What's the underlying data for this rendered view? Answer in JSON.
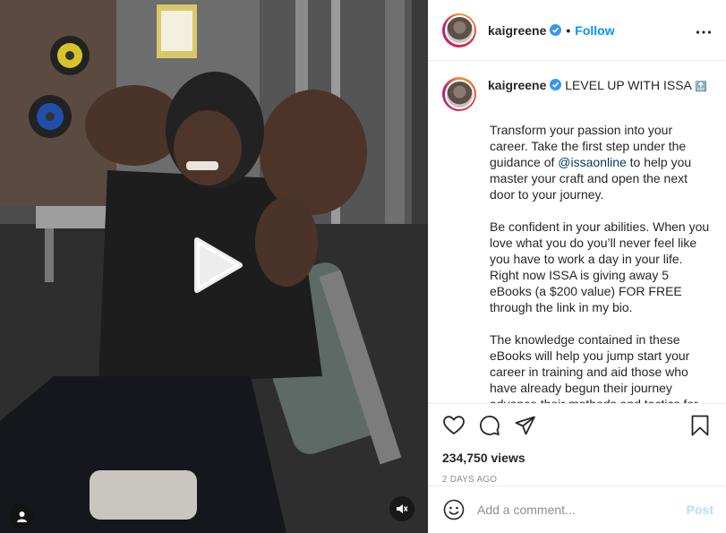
{
  "post": {
    "username": "kaigreene",
    "follow_label": "Follow",
    "separator": "•",
    "more_icon": "more-horizontal-icon"
  },
  "caption": {
    "username": "kaigreene",
    "headline": "LEVEL UP WITH ISSA",
    "headline_emoji": "🔝",
    "para1_before": "Transform your passion into your career. Take the first step under the guidance of ",
    "mention": "@issaonline",
    "para1_after": " to help you master your craft and open the next door to your journey.",
    "para2": "Be confident in your abilities. When you love what you do you’ll never feel like you have to work a day in your life. Right now ISSA is giving away 5 eBooks (a $200 value) FOR FREE through the link in my bio.",
    "para3": "The knowledge contained in these eBooks will help you jump start your career in training and aid those who have already begun their journey advance their methods and tactics for"
  },
  "stats": {
    "views": "234,750 views",
    "date": "2 DAYS AGO"
  },
  "comment": {
    "placeholder": "Add a comment...",
    "post_label": "Post"
  },
  "colors": {
    "accent": "#0095f6",
    "mention": "#00376b",
    "post_disabled": "#b2dffc",
    "muted": "#8e8e8e"
  }
}
